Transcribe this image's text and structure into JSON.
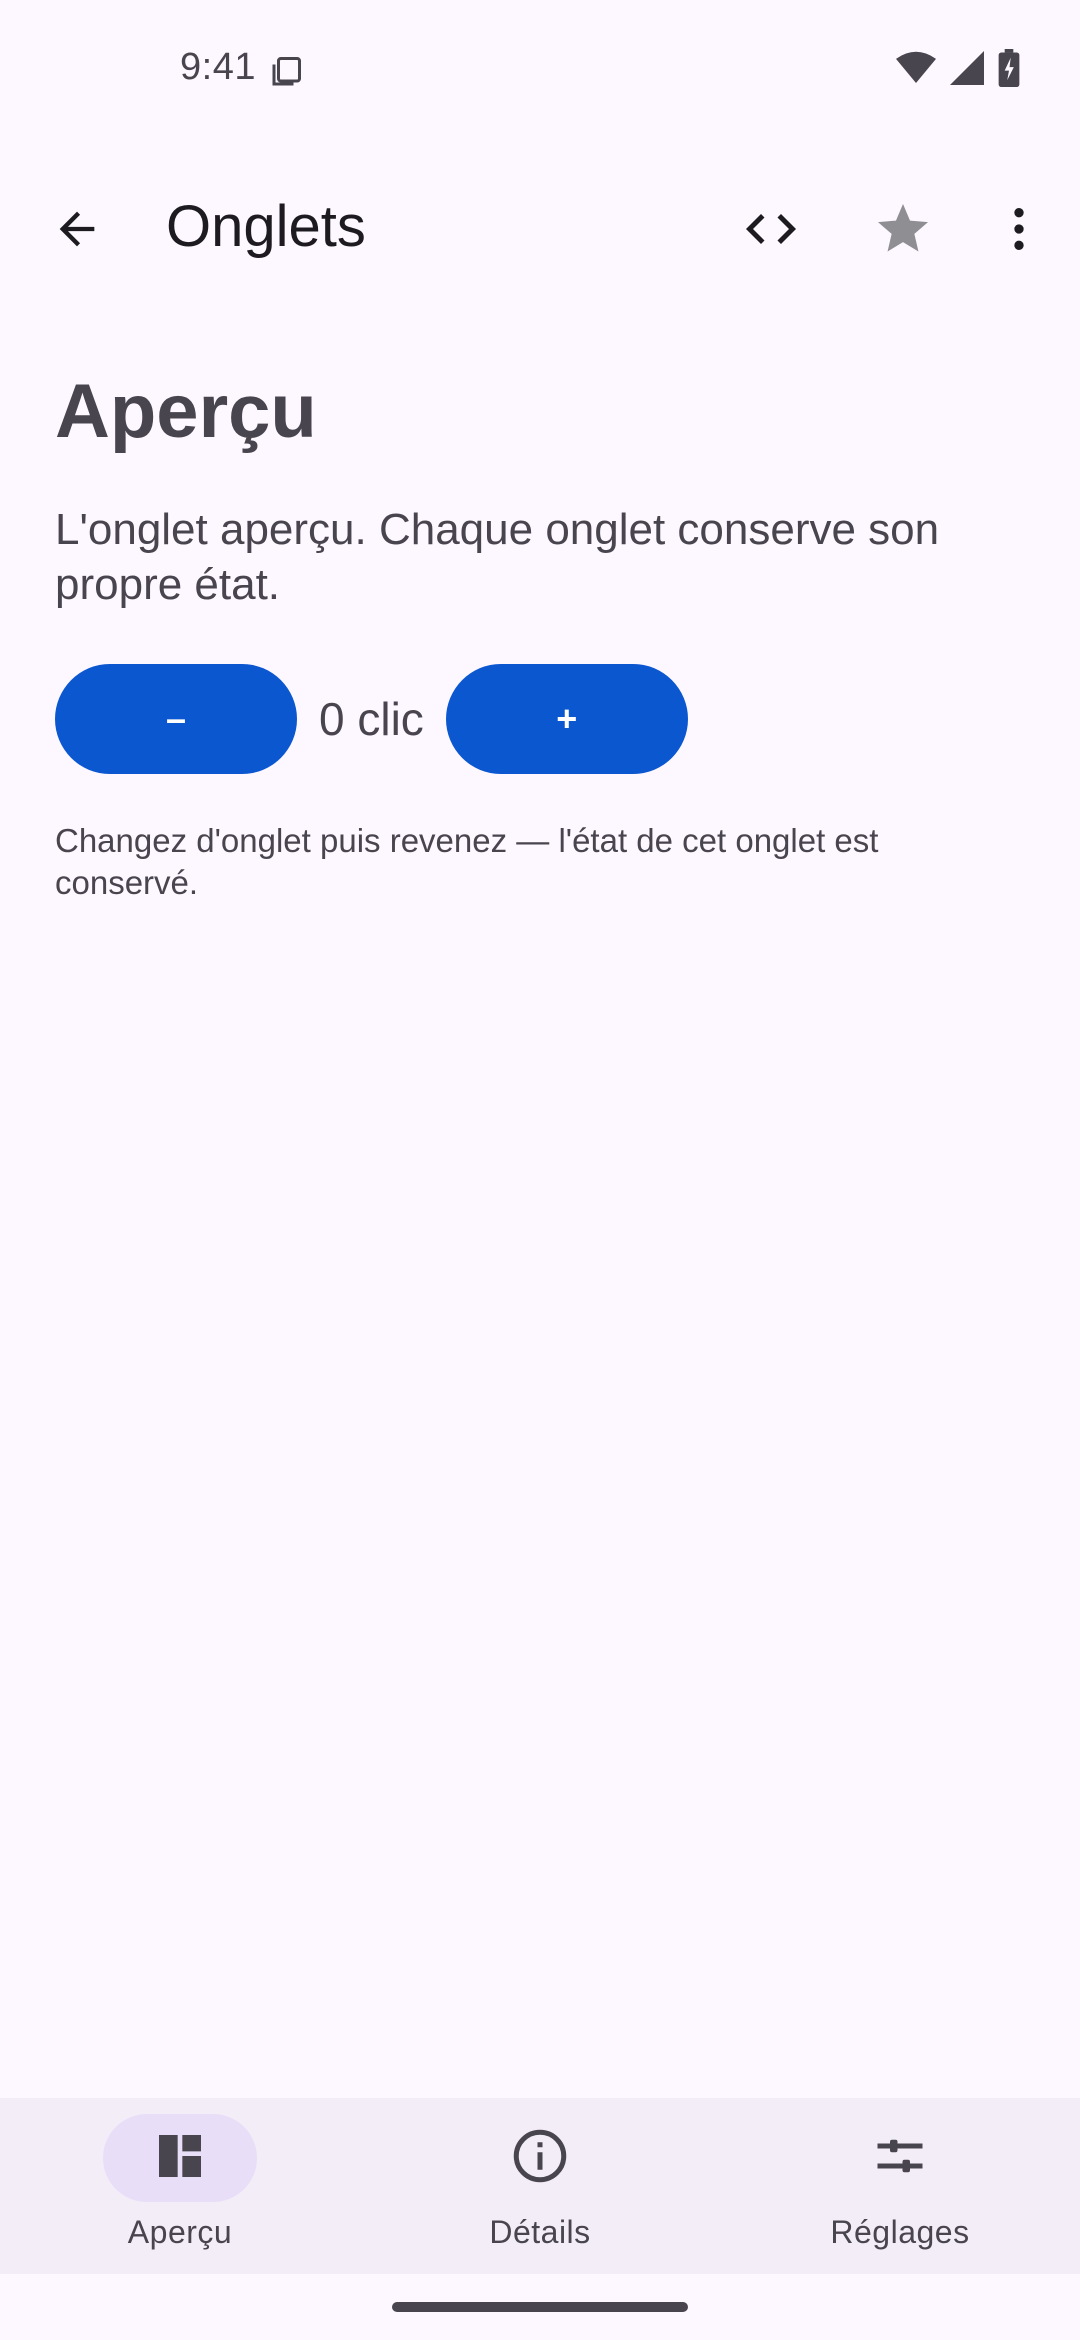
{
  "status_bar": {
    "time": "9:41"
  },
  "app_bar": {
    "title": "Onglets",
    "icons": [
      "back-arrow-icon",
      "code-icon",
      "star-icon",
      "more-vert-icon"
    ]
  },
  "tab_content": {
    "heading": "Aperçu",
    "description": "L'onglet aperçu. Chaque onglet conserve son propre état.",
    "decrement_label": "–",
    "counter_text": "0 clic",
    "increment_label": "+",
    "hint": "Changez d'onglet puis revenez — l'état de cet onglet est conservé."
  },
  "bottom_nav": {
    "items": [
      {
        "label": "Aperçu",
        "icon": "dashboard-icon",
        "active": true
      },
      {
        "label": "Détails",
        "icon": "info-icon",
        "active": false
      },
      {
        "label": "Réglages",
        "icon": "tune-icon",
        "active": false
      }
    ]
  },
  "colors": {
    "background": "#fdf7ff",
    "primary_button": "#0b57d0",
    "nav_background": "#f3edf7",
    "nav_active_indicator": "#e8def8",
    "text_secondary": "#49454f",
    "star_icon": "#8e8e93"
  }
}
